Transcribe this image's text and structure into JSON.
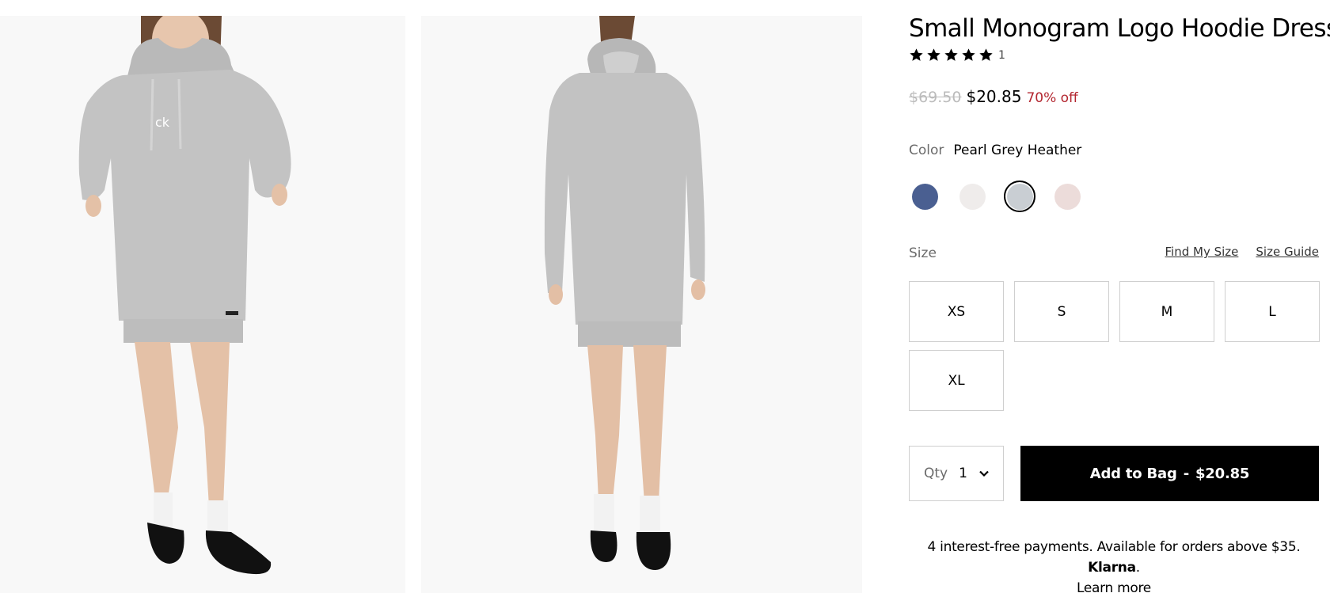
{
  "product": {
    "title": "Small Monogram Logo Hoodie Dress",
    "rating_count": "1",
    "stars": 5,
    "price_original": "$69.50",
    "price_sale": "$20.85",
    "discount": "70% off"
  },
  "color": {
    "label": "Color",
    "selected_name": "Pearl Grey Heather",
    "swatches": [
      {
        "name": "navy-heather",
        "hex": "#4a5f91",
        "selected": false
      },
      {
        "name": "off-white",
        "hex": "#efeceb",
        "selected": false
      },
      {
        "name": "pearl-grey-heather",
        "hex": "#c9ced3",
        "selected": true
      },
      {
        "name": "blush",
        "hex": "#ecdcda",
        "selected": false
      }
    ]
  },
  "size": {
    "label": "Size",
    "find_my_size": "Find My Size",
    "size_guide": "Size Guide",
    "options": [
      "XS",
      "S",
      "M",
      "L",
      "XL"
    ]
  },
  "purchase": {
    "qty_label": "Qty",
    "qty_value": "1",
    "add_label": "Add to Bag",
    "separator": "-",
    "add_price": "$20.85"
  },
  "klarna": {
    "text": "4 interest-free payments. Available for orders above $35.",
    "brand": "Klarna",
    "period": ".",
    "learn_more": "Learn more"
  },
  "gallery": {
    "front_view": "front",
    "back_view": "back"
  },
  "colors": {
    "sale_red": "#b3262f",
    "button_black": "#000000"
  }
}
